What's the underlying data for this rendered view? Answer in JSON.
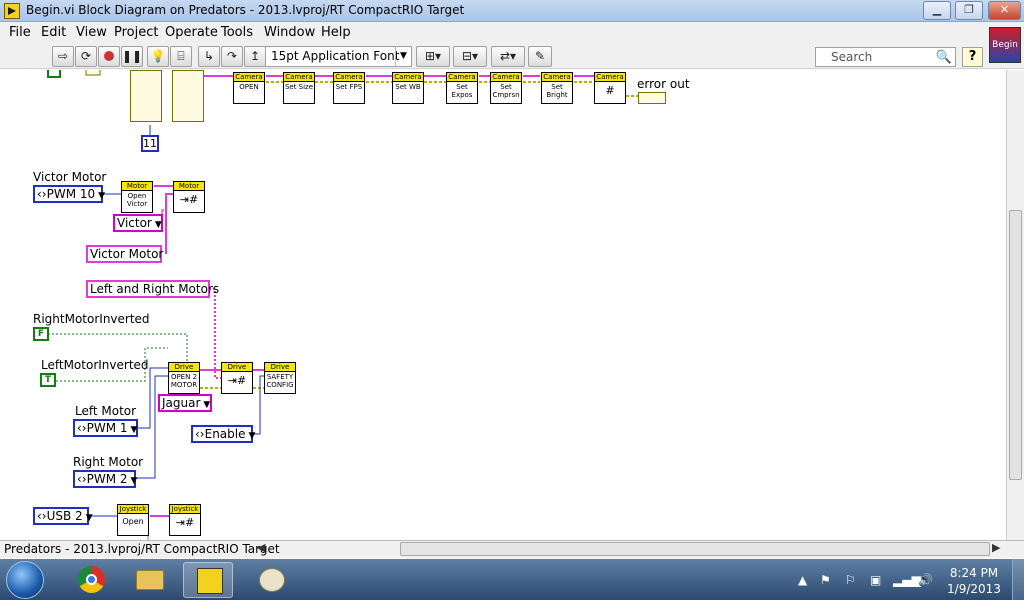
{
  "window": {
    "title": "Begin.vi Block Diagram on Predators - 2013.lvproj/RT CompactRIO Target",
    "min_glyph": "▁",
    "max_glyph": "❐",
    "close_glyph": "✕"
  },
  "menu": [
    "File",
    "Edit",
    "View",
    "Project",
    "Operate",
    "Tools",
    "Window",
    "Help"
  ],
  "toolbar": {
    "font_select": "15pt Application Font",
    "search_placeholder": "Search",
    "help_label": "?",
    "vi_icon_label": "Begin"
  },
  "diagram": {
    "camera_nodes": [
      {
        "hdr": "Camera",
        "body": "OPEN"
      },
      {
        "hdr": "Camera",
        "body": "Set Size"
      },
      {
        "hdr": "Camera",
        "body": "Set FPS"
      },
      {
        "hdr": "Camera",
        "body": "Set WB"
      },
      {
        "hdr": "Camera",
        "body": "Set Expos"
      },
      {
        "hdr": "Camera",
        "body": "Set Cmprsn"
      },
      {
        "hdr": "Camera",
        "body": "Set Bright"
      },
      {
        "hdr": "Camera",
        "body": "#"
      }
    ],
    "error_out": "error out",
    "const_11": "11",
    "victor_motor_label": "Victor Motor",
    "pwm10": "PWM 10",
    "motor_open_hdr": "Motor",
    "motor_open_body": "Open Victor",
    "motor_ref_hdr": "Motor",
    "victor_enum": "Victor",
    "victor_motor_str": "Victor Motor",
    "left_right_str": "Left and Right Motors",
    "right_inverted_label": "RightMotorInverted",
    "right_inverted_val": "F",
    "left_inverted_label": "LeftMotorInverted",
    "left_inverted_val": "T",
    "drive_open_hdr": "Drive",
    "drive_open_body": "OPEN 2 MOTOR",
    "drive_ref_hdr": "Drive",
    "drive_safety_hdr": "Drive",
    "drive_safety_body": "SAFETY CONFIG",
    "jaguar_enum": "Jaguar",
    "enable_enum": "Enable",
    "left_motor_label": "Left Motor",
    "pwm1": "PWM 1",
    "right_motor_label": "Right Motor",
    "pwm2": "PWM 2",
    "usb2": "USB 2",
    "joystick_open_hdr": "Joystick",
    "joystick_open_body": "Open",
    "joystick_ref_hdr": "Joystick"
  },
  "status": {
    "project_path": "Predators - 2013.lvproj/RT CompactRIO Target"
  },
  "taskbar": {
    "time": "8:24 PM",
    "date": "1/9/2013"
  },
  "colors": {
    "ring_blue": "#1f2fbf",
    "string_pink": "#e03bd8",
    "bool_green": "#0f7f0f",
    "vi_header_yellow": "#f7e600"
  }
}
